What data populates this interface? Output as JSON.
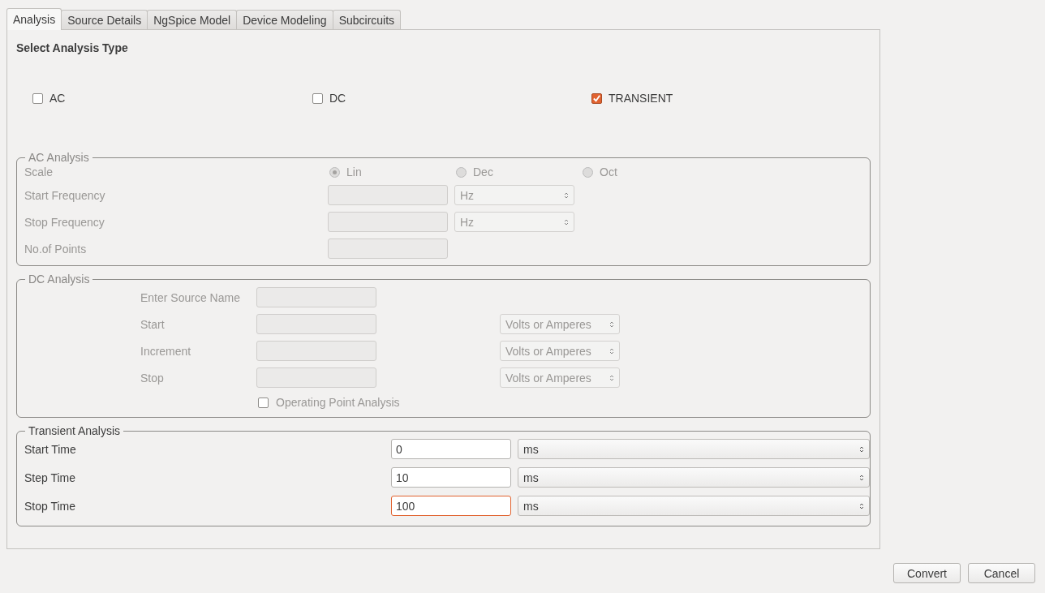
{
  "tabs": [
    {
      "label": "Analysis",
      "selected": true
    },
    {
      "label": "Source Details",
      "selected": false
    },
    {
      "label": "NgSpice Model",
      "selected": false
    },
    {
      "label": "Device Modeling",
      "selected": false
    },
    {
      "label": "Subcircuits",
      "selected": false
    }
  ],
  "panel": {
    "heading": "Select Analysis Type",
    "analysis_types": [
      {
        "label": "AC",
        "checked": false
      },
      {
        "label": "DC",
        "checked": false
      },
      {
        "label": "TRANSIENT",
        "checked": true
      }
    ],
    "ac_analysis": {
      "title": "AC Analysis",
      "disabled": true,
      "scale_label": "Scale",
      "scale_options": [
        {
          "label": "Lin",
          "selected": true
        },
        {
          "label": "Dec",
          "selected": false
        },
        {
          "label": "Oct",
          "selected": false
        }
      ],
      "rows": [
        {
          "label": "Start Frequency",
          "unit": "Hz"
        },
        {
          "label": "Stop Frequency",
          "unit": "Hz"
        },
        {
          "label": "No.of Points"
        }
      ]
    },
    "dc_analysis": {
      "title": "DC Analysis",
      "disabled": true,
      "rows": [
        {
          "label": "Enter Source Name"
        },
        {
          "label": "Start",
          "unit": "Volts or Amperes"
        },
        {
          "label": "Increment",
          "unit": "Volts or Amperes"
        },
        {
          "label": "Stop",
          "unit": "Volts or Amperes"
        }
      ],
      "operating_point": {
        "label": "Operating Point Analysis",
        "checked": false
      }
    },
    "transient_analysis": {
      "title": "Transient Analysis",
      "disabled": false,
      "rows": [
        {
          "label": "Start Time",
          "value": "0",
          "unit": "ms",
          "focused": false
        },
        {
          "label": "Step Time",
          "value": "10",
          "unit": "ms",
          "focused": false
        },
        {
          "label": "Stop Time",
          "value": "100",
          "unit": "ms",
          "focused": true
        }
      ]
    }
  },
  "buttons": [
    "Convert",
    "Cancel"
  ]
}
